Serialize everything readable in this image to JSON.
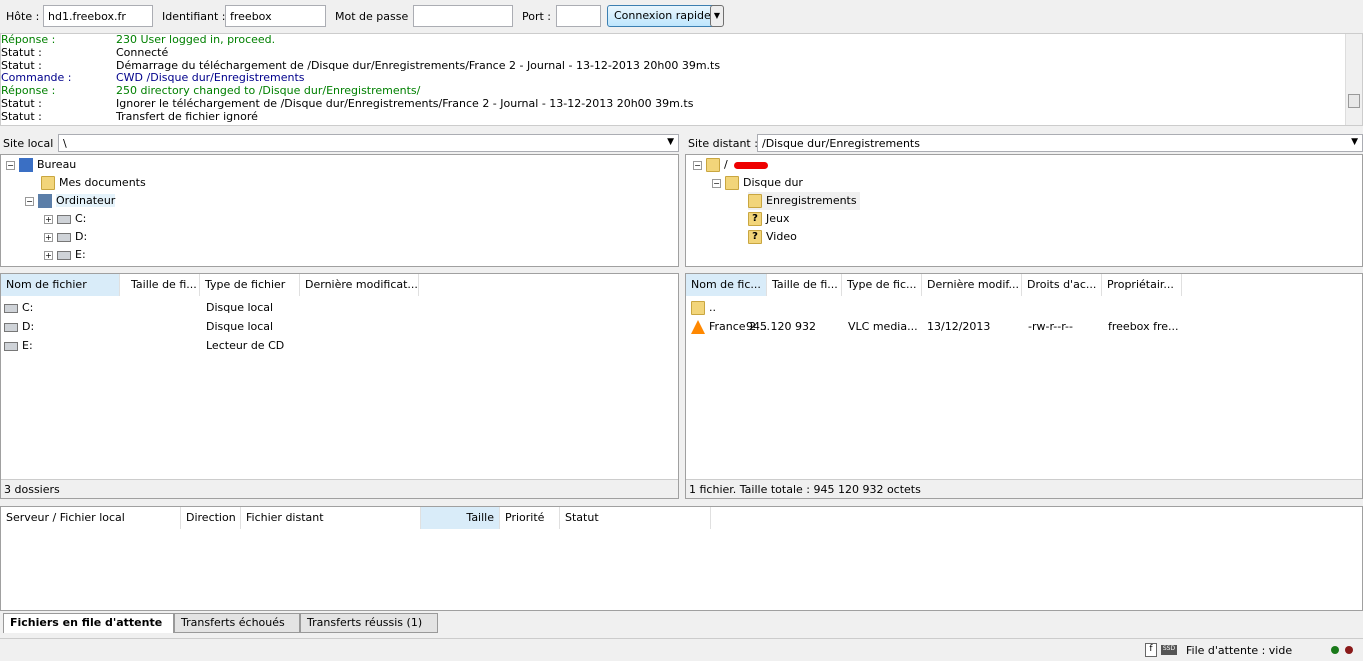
{
  "toolbar": {
    "host_label": "Hôte :",
    "host": "hd1.freebox.fr",
    "user_label": "Identifiant :",
    "user": "freebox",
    "pass_label": "Mot de passe :",
    "pass": "",
    "port_label": "Port :",
    "port": "",
    "connect": "Connexion rapide"
  },
  "log": [
    {
      "k": "Réponse :",
      "v": "230 User logged in, proceed.",
      "t": "green"
    },
    {
      "k": "Statut :",
      "v": "Connecté",
      "t": ""
    },
    {
      "k": "Statut :",
      "v": "Démarrage du téléchargement de /Disque dur/Enregistrements/France 2 - Journal - 13-12-2013 20h00 39m.ts",
      "t": ""
    },
    {
      "k": "Commande :",
      "v": "CWD /Disque dur/Enregistrements",
      "t": "blue"
    },
    {
      "k": "Réponse :",
      "v": "250 directory changed to /Disque dur/Enregistrements/",
      "t": "green"
    },
    {
      "k": "Statut :",
      "v": "Ignorer le téléchargement de /Disque dur/Enregistrements/France 2 - Journal - 13-12-2013 20h00 39m.ts",
      "t": ""
    },
    {
      "k": "Statut :",
      "v": "Transfert de fichier ignoré",
      "t": ""
    }
  ],
  "local": {
    "site_label": "Site local :",
    "path": "\\",
    "tree": [
      "Bureau",
      "Mes documents",
      "Ordinateur",
      "C:",
      "D:",
      "E:"
    ],
    "headers": [
      "Nom de fichier",
      "Taille de fi...",
      "Type de fichier",
      "Dernière modificat..."
    ],
    "files": [
      {
        "name": "C:",
        "type": "Disque local"
      },
      {
        "name": "D:",
        "type": "Disque local"
      },
      {
        "name": "E:",
        "type": "Lecteur de CD"
      }
    ],
    "status": "3 dossiers"
  },
  "remote": {
    "site_label": "Site distant :",
    "path": "/Disque dur/Enregistrements",
    "tree": [
      "/",
      "Disque dur",
      "Enregistrements",
      "Jeux",
      "Video"
    ],
    "headers": [
      "Nom de fic...",
      "Taille de fi...",
      "Type de fic...",
      "Dernière modif...",
      "Droits d'ac...",
      "Propriétair..."
    ],
    "files": [
      {
        "name": ".."
      },
      {
        "name": "France 2 ...",
        "size": "945 120 932",
        "type": "VLC media...",
        "date": "13/12/2013",
        "perm": "-rw-r--r--",
        "owner": "freebox fre..."
      }
    ],
    "status": "1 fichier. Taille totale : 945 120 932 octets"
  },
  "queue": {
    "headers": [
      "Serveur / Fichier local",
      "Direction",
      "Fichier distant",
      "Taille",
      "Priorité",
      "Statut"
    ]
  },
  "tabs": [
    "Fichiers en file d'attente",
    "Transferts échoués",
    "Transferts réussis (1)"
  ],
  "statusbar": {
    "queue": "File d'attente : vide"
  }
}
